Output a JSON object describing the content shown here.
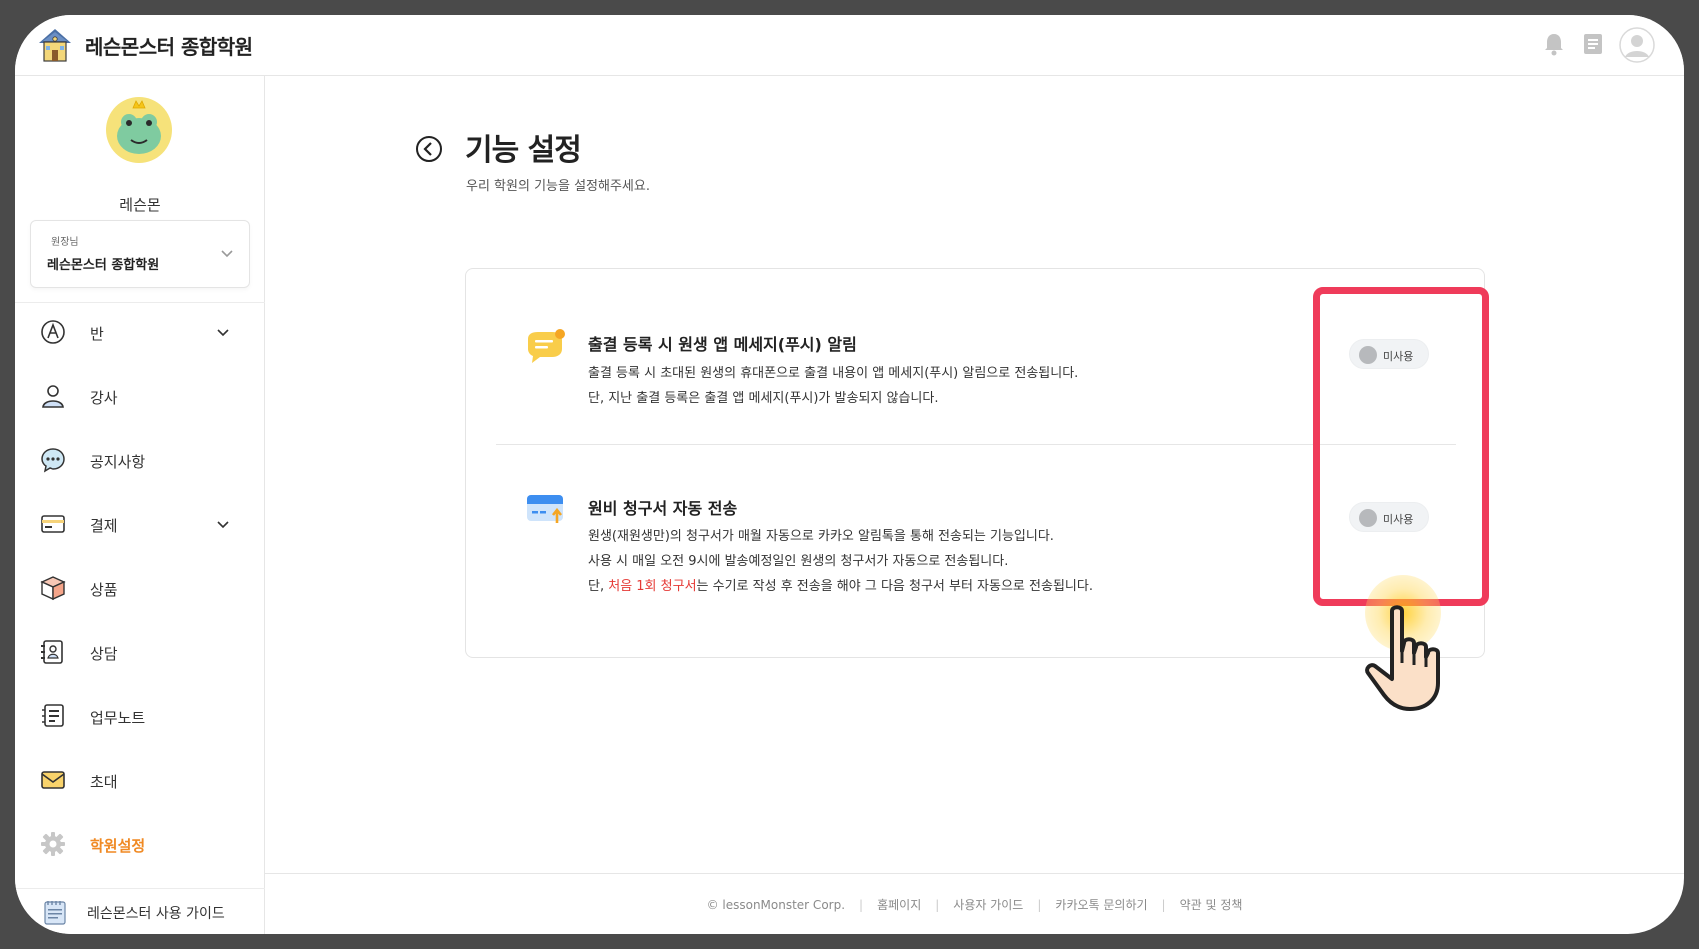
{
  "header": {
    "brand": "레슨몬스터 종합학원",
    "icons": [
      "school-logo-icon",
      "bell-icon",
      "document-icon",
      "user-avatar-icon"
    ]
  },
  "sidebar": {
    "user_name": "레슨몬",
    "academy": {
      "role": "원장님",
      "name": "레슨몬스터 종합학원"
    },
    "items": [
      {
        "label": "반",
        "icon": "class-icon",
        "has_chevron": true
      },
      {
        "label": "강사",
        "icon": "teacher-icon",
        "has_chevron": false
      },
      {
        "label": "공지사항",
        "icon": "notice-chat-icon",
        "has_chevron": false
      },
      {
        "label": "결제",
        "icon": "card-icon",
        "has_chevron": true
      },
      {
        "label": "상품",
        "icon": "box-icon",
        "has_chevron": false
      },
      {
        "label": "상담",
        "icon": "consult-icon",
        "has_chevron": false
      },
      {
        "label": "업무노트",
        "icon": "note-icon",
        "has_chevron": false
      },
      {
        "label": "초대",
        "icon": "mail-icon",
        "has_chevron": false
      },
      {
        "label": "학원설정",
        "icon": "gear-icon",
        "has_chevron": false,
        "active": true
      }
    ],
    "guide_label": "레슨몬스터 사용 가이드",
    "accent_color": "#f08a24"
  },
  "main": {
    "title": "기능 설정",
    "subtitle": "우리 학원의 기능을 설정해주세요.",
    "features": [
      {
        "title": "출결 등록 시 원생 앱 메세지(푸시) 알림",
        "lines": [
          "출결 등록 시 초대된 원생의 휴대폰으로 출결 내용이 앱 메세지(푸시) 알림으로 전송됩니다.",
          "단, 지난 출결 등록은 출결 앱 메세지(푸시)가 발송되지 않습니다."
        ],
        "toggle_label": "미사용"
      },
      {
        "title": "원비 청구서 자동 전송",
        "lines": [
          "원생(재원생만)의 청구서가 매월 자동으로 카카오 알림톡을 통해 전송되는 기능입니다.",
          "사용 시 매일 오전 9시에 발송예정일인 원생의 청구서가 자동으로 전송됩니다."
        ],
        "line3_prefix": "단, ",
        "line3_highlight": "처음 1회 청구서",
        "line3_suffix": "는 수기로 작성 후 전송을 해야 그 다음 청구서 부터 자동으로 전송됩니다.",
        "toggle_label": "미사용"
      }
    ],
    "highlight_color": "#ef3b5a"
  },
  "footer": {
    "links": [
      "© lessonMonster Corp.",
      "홈페이지",
      "사용자 가이드",
      "카카오톡 문의하기",
      "약관 및 정책"
    ]
  }
}
